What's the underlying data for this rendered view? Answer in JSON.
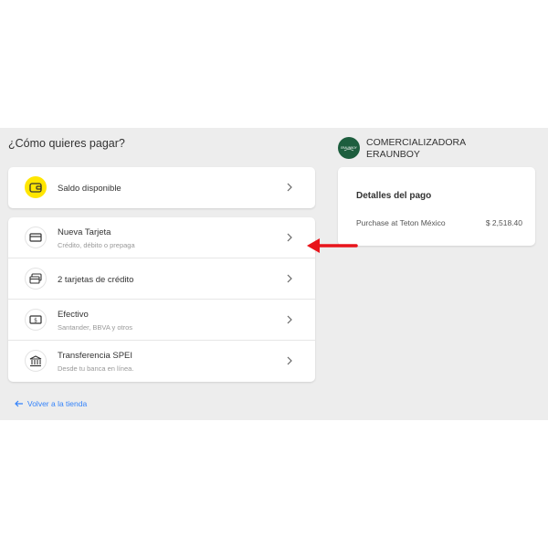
{
  "page": {
    "title": "¿Cómo quieres pagar?",
    "back_link": "Volver a la tienda"
  },
  "balance": {
    "label": "Saldo disponible",
    "icon": "wallet-icon"
  },
  "methods": [
    {
      "label": "Nueva Tarjeta",
      "sublabel": "Crédito, débito o prepaga",
      "icon": "card-icon"
    },
    {
      "label": "2 tarjetas de crédito",
      "sublabel": "",
      "icon": "cards-icon"
    },
    {
      "label": "Efectivo",
      "sublabel": "Santander, BBVA y otros",
      "icon": "cash-icon"
    },
    {
      "label": "Transferencia SPEI",
      "sublabel": "Desde tu banca en línea.",
      "icon": "bank-icon"
    }
  ],
  "merchant": {
    "name": "COMERCIALIZADORA ERAUNBOY",
    "logo_text": "ERAUNBOY"
  },
  "details": {
    "title": "Detalles del pago",
    "description": "Purchase at Teton México",
    "amount": "$ 2,518.40"
  },
  "colors": {
    "panel_background": "#ededed",
    "accent_blue": "#3483fa",
    "wallet_yellow": "#ffe600",
    "merchant_green": "#1d5e3e",
    "annotation_arrow": "#e8141b"
  }
}
